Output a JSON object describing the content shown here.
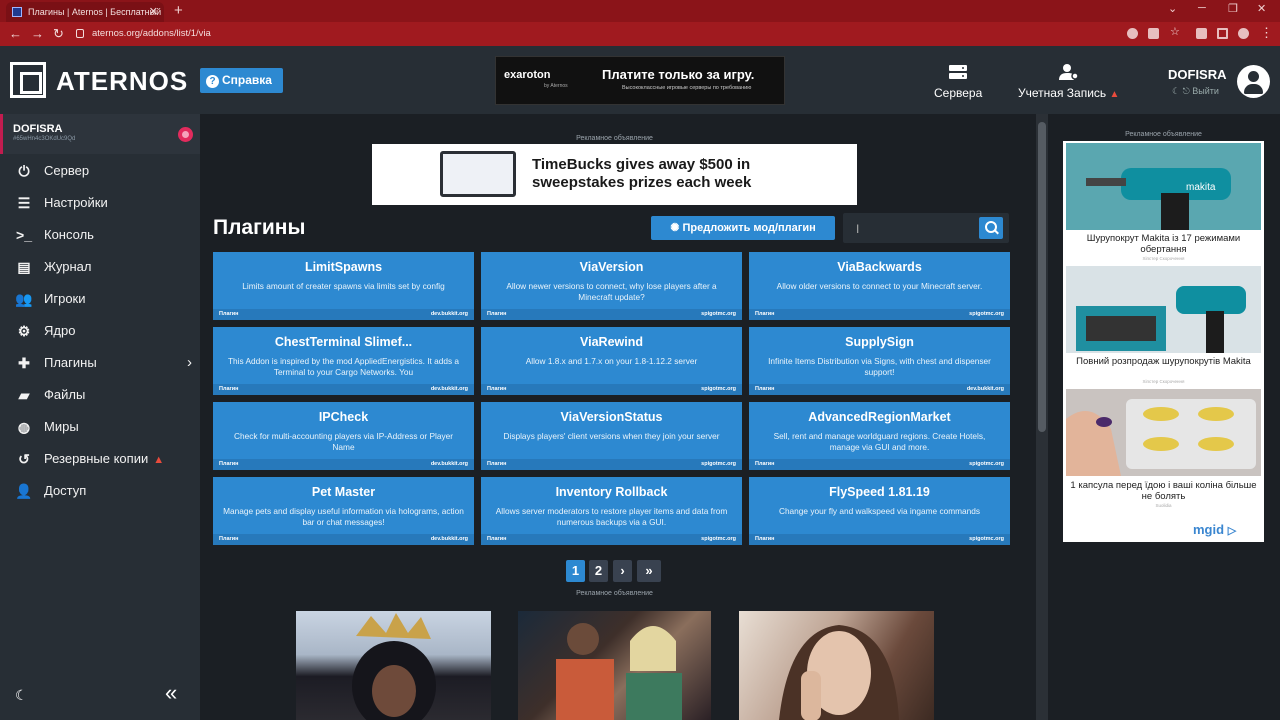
{
  "browser": {
    "tab_title": "Плагины | Aternos | Бесплатный",
    "url": "aternos.org/addons/list/1/via"
  },
  "header": {
    "logo": "ATERNOS",
    "help": "Справка",
    "ad": {
      "brand": "exaroton",
      "brand_sub": "by Aternos",
      "headline": "Платите только за игру.",
      "sub": "Высококлассные игровые серверы по требованию"
    },
    "nav_servers": "Сервера",
    "nav_account": "Учетная Запись",
    "user_name": "DOFISRA",
    "logout": "Выйти"
  },
  "sidebar": {
    "server_name": "DOFISRA",
    "server_id": "#65wHn4c3OKdUc9Qd",
    "items": [
      {
        "label": "Сервер",
        "icon": "power-icon"
      },
      {
        "label": "Настройки",
        "icon": "sliders-icon"
      },
      {
        "label": "Консоль",
        "icon": "terminal-icon"
      },
      {
        "label": "Журнал",
        "icon": "file-icon"
      },
      {
        "label": "Игроки",
        "icon": "users-icon"
      },
      {
        "label": "Ядро",
        "icon": "gears-icon"
      },
      {
        "label": "Плагины",
        "icon": "puzzle-icon"
      },
      {
        "label": "Файлы",
        "icon": "folder-icon"
      },
      {
        "label": "Миры",
        "icon": "globe-icon"
      },
      {
        "label": "Резервные копии",
        "icon": "history-icon"
      },
      {
        "label": "Доступ",
        "icon": "user-lock-icon"
      }
    ]
  },
  "main": {
    "ad_label": "Рекламное объявление",
    "banner_text": "TimeBucks gives away $500 in sweepstakes prizes each week",
    "title": "Плагины",
    "suggest": "Предложить мод/плагин",
    "search_placeholder": "",
    "plugins": [
      {
        "title": "LimitSpawns",
        "desc": "Limits amount of creater spawns via limits set by config",
        "type": "Плагин",
        "source": "dev.bukkit.org"
      },
      {
        "title": "ViaVersion",
        "desc": "Allow newer versions to connect, why lose players after a Minecraft update?",
        "type": "Плагин",
        "source": "spigotmc.org"
      },
      {
        "title": "ViaBackwards",
        "desc": "Allow older versions to connect to your Minecraft server.",
        "type": "Плагин",
        "source": "spigotmc.org"
      },
      {
        "title": "ChestTerminal Slimef...",
        "desc": "This Addon is inspired by the mod AppliedEnergistics. It adds a Terminal to your Cargo Networks. You",
        "type": "Плагин",
        "source": "dev.bukkit.org"
      },
      {
        "title": "ViaRewind",
        "desc": "Allow 1.8.x and 1.7.x on your 1.8-1.12.2 server",
        "type": "Плагин",
        "source": "spigotmc.org"
      },
      {
        "title": "SupplySign",
        "desc": "Infinite Items Distribution via Signs, with chest and dispenser support!",
        "type": "Плагин",
        "source": "dev.bukkit.org"
      },
      {
        "title": "IPCheck",
        "desc": "Check for multi-accounting players via IP-Address or Player Name",
        "type": "Плагин",
        "source": "dev.bukkit.org"
      },
      {
        "title": "ViaVersionStatus",
        "desc": "Displays players' client versions when they join your server",
        "type": "Плагин",
        "source": "spigotmc.org"
      },
      {
        "title": "AdvancedRegionMarket",
        "desc": "Sell, rent and manage worldguard regions. Create Hotels, manage via GUI and more.",
        "type": "Плагин",
        "source": "spigotmc.org"
      },
      {
        "title": "Pet Master",
        "desc": "Manage pets and display useful information via holograms, action bar or chat messages!",
        "type": "Плагин",
        "source": "dev.bukkit.org"
      },
      {
        "title": "Inventory Rollback",
        "desc": "Allows server moderators to restore player items and data from numerous backups via a GUI.",
        "type": "Плагин",
        "source": "spigotmc.org"
      },
      {
        "title": "FlySpeed 1.81.19",
        "desc": "Change your fly and walkspeed via ingame commands",
        "type": "Плагин",
        "source": "spigotmc.org"
      }
    ],
    "pages": [
      "1",
      "2",
      "›",
      "»"
    ]
  },
  "right_ad": {
    "label": "Рекламное объявление",
    "items": [
      {
        "caption": "Шурупокрут Makita із 17 режимами обертання",
        "source": "Хіпстер Скорочення"
      },
      {
        "caption": "Повний розпродаж шурупокрутів Makita",
        "source": "Хіпстер Скорочення"
      },
      {
        "caption": "1 капсула перед їдою і ваші коліна більше не болять",
        "source": "Suolidia"
      }
    ],
    "network": "mgid"
  },
  "colors": {
    "accent": "#2d89d1",
    "brand_red": "#a01a1f",
    "panel": "#272e35",
    "status": "#e22b5d"
  }
}
